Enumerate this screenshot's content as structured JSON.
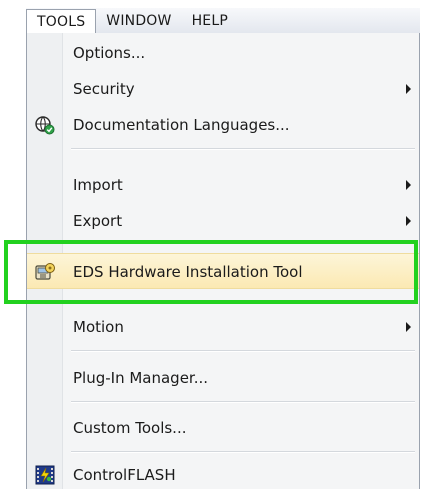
{
  "menubar": {
    "items": [
      {
        "label": "TOOLS"
      },
      {
        "label": "WINDOW"
      },
      {
        "label": "HELP"
      }
    ]
  },
  "menu": {
    "items": [
      {
        "label": "Options...",
        "icon": "",
        "submenu": false
      },
      {
        "label": "Security",
        "icon": "",
        "submenu": true
      },
      {
        "label": "Documentation Languages...",
        "icon": "globe-gear-icon",
        "submenu": false
      },
      {
        "label": "Import",
        "icon": "",
        "submenu": true
      },
      {
        "label": "Export",
        "icon": "",
        "submenu": true
      },
      {
        "label": "EDS Hardware Installation Tool",
        "icon": "hardware-install-icon",
        "submenu": false,
        "highlighted": true
      },
      {
        "label": "Motion",
        "icon": "",
        "submenu": true
      },
      {
        "label": "Plug-In Manager...",
        "icon": "",
        "submenu": false
      },
      {
        "label": "Custom Tools...",
        "icon": "",
        "submenu": false
      },
      {
        "label": "ControlFLASH",
        "icon": "controlflash-icon",
        "submenu": false
      }
    ]
  },
  "colors": {
    "highlight_box": "#22d11f",
    "hover_fill": "#fbe9b3"
  }
}
